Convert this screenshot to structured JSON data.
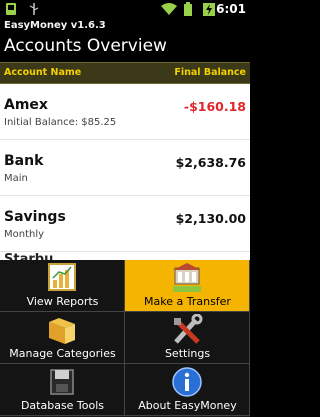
{
  "statusbar": {
    "time": "6:01"
  },
  "header": {
    "app_version": "EasyMoney v1.6.3",
    "title": "Accounts Overview"
  },
  "columns": {
    "name": "Account Name",
    "balance": "Final Balance"
  },
  "accounts": [
    {
      "name": "Amex",
      "sub": "Initial Balance: $85.25",
      "balance": "-$160.18",
      "negative": true
    },
    {
      "name": "Bank",
      "sub": "Main",
      "balance": "$2,638.76",
      "negative": false
    },
    {
      "name": "Savings",
      "sub": "Monthly",
      "balance": "$2,130.00",
      "negative": false
    }
  ],
  "ghost_row": "Starbu",
  "menu": [
    {
      "label": "View Reports",
      "icon": "chart-icon",
      "active": false
    },
    {
      "label": "Make a Transfer",
      "icon": "transfer-icon",
      "active": true
    },
    {
      "label": "Manage Categories",
      "icon": "folders-icon",
      "active": false
    },
    {
      "label": "Settings",
      "icon": "tools-icon",
      "active": false
    },
    {
      "label": "Database Tools",
      "icon": "database-icon",
      "active": false
    },
    {
      "label": "About EasyMoney",
      "icon": "info-icon",
      "active": false
    }
  ],
  "colors": {
    "accent": "#f5b400",
    "negative": "#e0262a",
    "header_bar": "#3b3918"
  }
}
